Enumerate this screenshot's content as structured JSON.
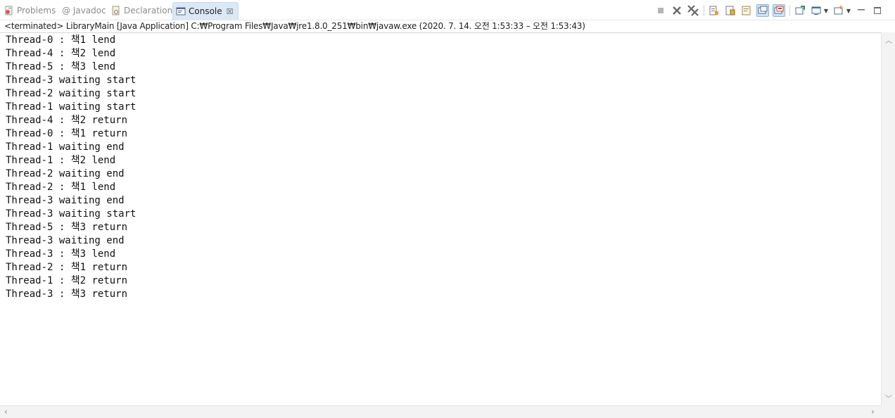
{
  "tabs": [
    {
      "label": "Problems",
      "icon": "problems-icon"
    },
    {
      "label": "@ Javadoc",
      "icon": "javadoc-icon"
    },
    {
      "label": "Declaration",
      "icon": "declaration-icon"
    },
    {
      "label": "Console",
      "icon": "console-icon",
      "close": "☒"
    }
  ],
  "status": {
    "text": "<terminated> LibraryMain [Java Application] C:₩Program Files₩Java₩jre1.8.0_251₩bin₩javaw.exe  (2020. 7. 14. 오전 1:53:33 – 오전 1:53:43)"
  },
  "console": {
    "lines": [
      "Thread-0 : 책1 lend",
      "Thread-4 : 책2 lend",
      "Thread-5 : 책3 lend",
      "Thread-3 waiting start",
      "Thread-2 waiting start",
      "Thread-1 waiting start",
      "Thread-4 : 책2 return",
      "Thread-0 : 책1 return",
      "Thread-1 waiting end",
      "Thread-1 : 책2 lend",
      "Thread-2 waiting end",
      "Thread-2 : 책1 lend",
      "Thread-3 waiting end",
      "Thread-3 waiting start",
      "Thread-5 : 책3 return",
      "Thread-3 waiting end",
      "Thread-3 : 책3 lend",
      "Thread-2 : 책1 return",
      "Thread-1 : 책2 return",
      "Thread-3 : 책3 return"
    ]
  },
  "toolbar_icons": [
    "terminate-icon",
    "remove-launch-icon",
    "remove-all-terminated-icon",
    "clear-console-icon",
    "scroll-lock-icon",
    "word-wrap-icon",
    "show-on-stdout-icon",
    "show-on-stderr-icon",
    "pin-console-icon",
    "display-selected-console-icon",
    "open-console-icon",
    "minimize-icon",
    "maximize-icon"
  ],
  "colors": {
    "accent": "#dbe8f5",
    "pressed": "#cfe2f6",
    "terminate_red": "#c0392b"
  }
}
